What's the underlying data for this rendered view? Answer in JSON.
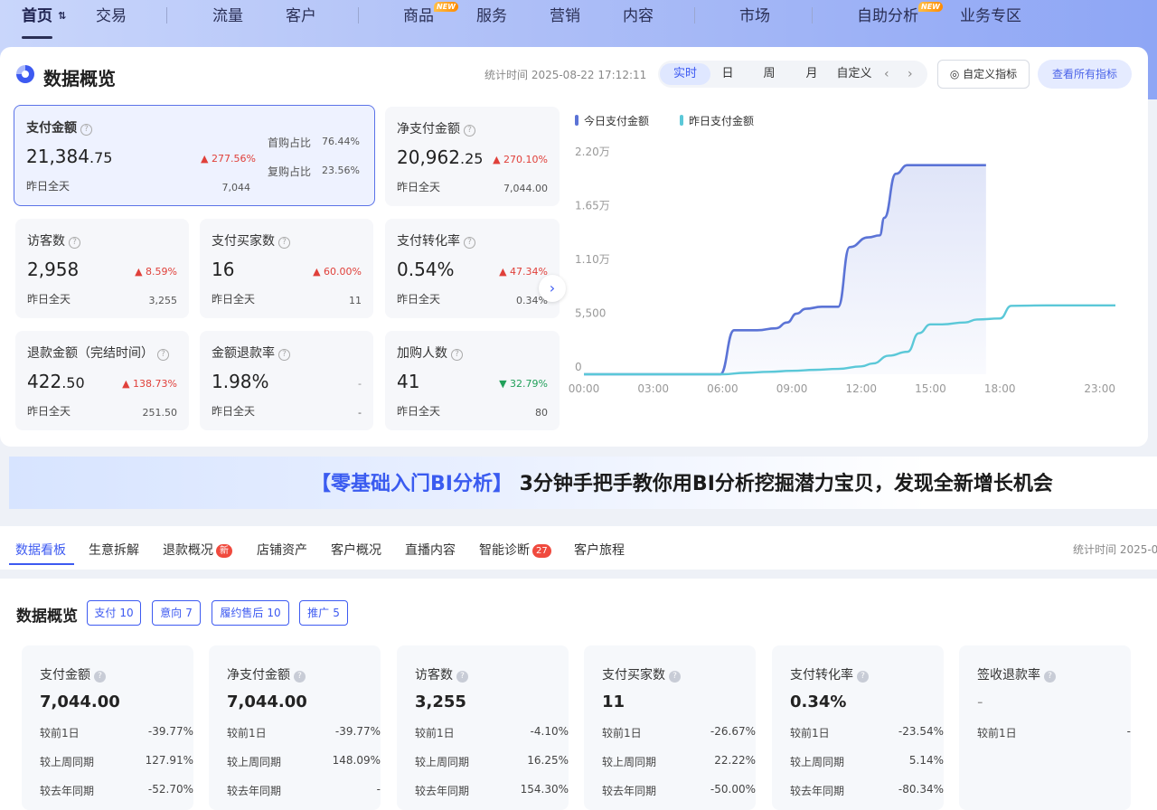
{
  "nav": {
    "items": [
      {
        "label": "首页",
        "active": true
      },
      {
        "label": "交易"
      },
      {
        "label": "流量"
      },
      {
        "label": "客户"
      },
      {
        "label": "商品",
        "badge": "NEW"
      },
      {
        "label": "服务"
      },
      {
        "label": "营销"
      },
      {
        "label": "内容"
      },
      {
        "label": "市场"
      },
      {
        "label": "自助分析",
        "badge": "NEW"
      },
      {
        "label": "业务专区"
      }
    ]
  },
  "overview": {
    "title": "数据概览",
    "stat_time": "统计时间 2025-08-22 17:12:11",
    "periods": [
      "实时",
      "日",
      "周",
      "月",
      "自定义"
    ],
    "custom_metric_button": "自定义指标",
    "view_all_button": "查看所有指标",
    "cards": [
      {
        "label": "支付金额",
        "value_int": "21,384",
        "value_dec": ".75",
        "change": "277.56%",
        "dir": "up",
        "yest_label": "昨日全天",
        "yest_value": "7,044",
        "first_label": "首购占比",
        "first_value": "76.44%",
        "repeat_label": "复购占比",
        "repeat_value": "23.56%"
      },
      {
        "label": "净支付金额",
        "value_int": "20,962",
        "value_dec": ".25",
        "change": "270.10%",
        "dir": "up",
        "yest_label": "昨日全天",
        "yest_value": "7,044.00"
      },
      {
        "label": "访客数",
        "value_int": "2,958",
        "value_dec": "",
        "change": "8.59%",
        "dir": "up",
        "yest_label": "昨日全天",
        "yest_value": "3,255"
      },
      {
        "label": "支付买家数",
        "value_int": "16",
        "value_dec": "",
        "change": "60.00%",
        "dir": "up",
        "yest_label": "昨日全天",
        "yest_value": "11"
      },
      {
        "label": "支付转化率",
        "value_int": "0.54%",
        "value_dec": "",
        "change": "47.34%",
        "dir": "up",
        "yest_label": "昨日全天",
        "yest_value": "0.34%"
      },
      {
        "label": "退款金额（完结时间）",
        "value_int": "422",
        "value_dec": ".50",
        "change": "138.73%",
        "dir": "up",
        "yest_label": "昨日全天",
        "yest_value": "251.50"
      },
      {
        "label": "金额退款率",
        "value_int": "1.98%",
        "value_dec": "",
        "change": "-",
        "dir": "none",
        "yest_label": "昨日全天",
        "yest_value": "-"
      },
      {
        "label": "加购人数",
        "value_int": "41",
        "value_dec": "",
        "change": "32.79%",
        "dir": "down",
        "yest_label": "昨日全天",
        "yest_value": "80"
      }
    ]
  },
  "chart_data": {
    "type": "area",
    "x_ticks": [
      "00:00",
      "03:00",
      "06:00",
      "09:00",
      "12:00",
      "15:00",
      "18:00",
      "23:00"
    ],
    "y_ticks": [
      "0",
      "5,500",
      "1.10万",
      "1.65万",
      "2.20万"
    ],
    "ylim": [
      0,
      22000
    ],
    "series": [
      {
        "name": "今日支付金额",
        "color": "#5b73d6",
        "x": [
          0,
          5.9,
          6.5,
          7.5,
          8.3,
          8.8,
          9.2,
          9.6,
          10.3,
          11.0,
          11.5,
          12.3,
          12.8,
          13.0,
          13.5,
          14.0,
          14.5,
          14.8,
          15.3,
          17.4
        ],
        "y": [
          0,
          0,
          4500,
          4500,
          4700,
          5300,
          6200,
          6700,
          6900,
          6900,
          13000,
          14000,
          14200,
          16000,
          20500,
          21384,
          21384,
          21384,
          21384,
          21384
        ]
      },
      {
        "name": "昨日支付金额",
        "color": "#5bc8d8",
        "x": [
          0,
          6.0,
          7.0,
          8.0,
          9.0,
          10.0,
          11.0,
          12.0,
          12.5,
          13.2,
          14.0,
          14.5,
          15.0,
          15.5,
          16.5,
          17.0,
          18.0,
          18.5,
          20.0,
          23.0
        ],
        "y": [
          0,
          0,
          150,
          250,
          350,
          450,
          550,
          800,
          1100,
          1900,
          2300,
          4200,
          5100,
          5100,
          5300,
          5600,
          5700,
          7000,
          7044,
          7044
        ]
      }
    ]
  },
  "banner": {
    "highlight": "【零基础入门BI分析】",
    "text": " 3分钟手把手教你用BI分析挖掘潜力宝贝，发现全新增长机会"
  },
  "tabs": {
    "items": [
      {
        "label": "数据看板",
        "active": true
      },
      {
        "label": "生意拆解"
      },
      {
        "label": "退款概况",
        "badge": "新"
      },
      {
        "label": "店铺资产"
      },
      {
        "label": "客户概况"
      },
      {
        "label": "直播内容"
      },
      {
        "label": "智能诊断",
        "badge": "27"
      },
      {
        "label": "客户旅程"
      }
    ],
    "stat_time": "统计时间 2025-0"
  },
  "bottom": {
    "title": "数据概览",
    "chips": [
      {
        "label": "支付",
        "count": "10"
      },
      {
        "label": "意向",
        "count": "7"
      },
      {
        "label": "履约售后",
        "count": "10"
      },
      {
        "label": "推广",
        "count": "5"
      }
    ],
    "cards": [
      {
        "label": "支付金额",
        "value": "7,044.00",
        "rows": [
          [
            "较前1日",
            "-39.77%"
          ],
          [
            "较上周同期",
            "127.91%"
          ],
          [
            "较去年同期",
            "-52.70%"
          ]
        ]
      },
      {
        "label": "净支付金额",
        "value": "7,044.00",
        "rows": [
          [
            "较前1日",
            "-39.77%"
          ],
          [
            "较上周同期",
            "148.09%"
          ],
          [
            "较去年同期",
            "-"
          ]
        ]
      },
      {
        "label": "访客数",
        "value": "3,255",
        "rows": [
          [
            "较前1日",
            "-4.10%"
          ],
          [
            "较上周同期",
            "16.25%"
          ],
          [
            "较去年同期",
            "154.30%"
          ]
        ]
      },
      {
        "label": "支付买家数",
        "value": "11",
        "rows": [
          [
            "较前1日",
            "-26.67%"
          ],
          [
            "较上周同期",
            "22.22%"
          ],
          [
            "较去年同期",
            "-50.00%"
          ]
        ]
      },
      {
        "label": "支付转化率",
        "value": "0.34%",
        "rows": [
          [
            "较前1日",
            "-23.54%"
          ],
          [
            "较上周同期",
            "5.14%"
          ],
          [
            "较去年同期",
            "-80.34%"
          ]
        ]
      },
      {
        "label": "签收退款率",
        "value": "-",
        "rows": [
          [
            "较前1日",
            "-"
          ],
          [
            "",
            ""
          ],
          [
            "",
            ""
          ]
        ]
      }
    ]
  }
}
